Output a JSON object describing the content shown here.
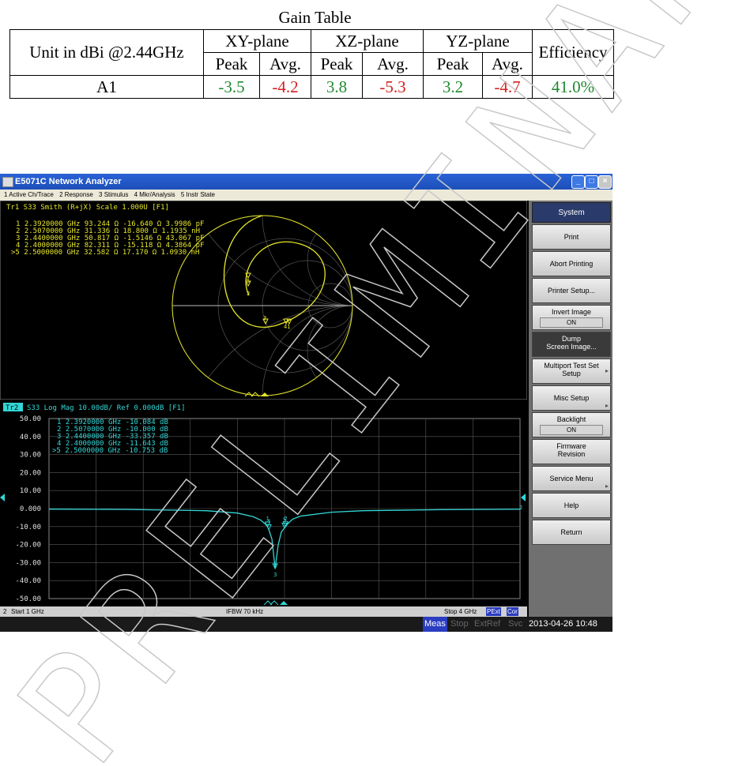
{
  "gain_table": {
    "title": "Gain Table",
    "unit_header": "Unit in dBi @2.44GHz",
    "planes": [
      "XY-plane",
      "XZ-plane",
      "YZ-plane"
    ],
    "efficiency_header": "Efficiency",
    "peak_label": "Peak",
    "avg_label": "Avg.",
    "row": {
      "name": "A1",
      "xy_peak": "-3.5",
      "xy_avg": "-4.2",
      "xz_peak": "3.8",
      "xz_avg": "-5.3",
      "yz_peak": "3.2",
      "yz_avg": "-4.7",
      "efficiency": "41.0%"
    }
  },
  "window": {
    "title": "E5071C Network Analyzer",
    "menu": [
      "1 Active Ch/Trace",
      "2 Response",
      "3 Stimulus",
      "4 Mkr/Analysis",
      "5 Instr State"
    ]
  },
  "smith": {
    "header": "Tr1  S33  Smith (R+jX)  Scale 1.000U  [F1]",
    "markers": [
      "1   2.3920000 GHz   93.244 Ω  -16.640 Ω   3.9986 pF",
      "2   2.5070000 GHz   31.336 Ω   18.800 Ω   1.1935 nH",
      "3   2.4400000 GHz   50.817 Ω  -1.5146 Ω  43.067 pF",
      "4   2.4000000 GHz   82.311 Ω  -15.118 Ω   4.3864 pF",
      ">5   2.5000000 GHz   32.582 Ω   17.170 Ω   1.0930 nH"
    ],
    "marker_tags": [
      "1",
      "2",
      "3",
      "4",
      "5",
      "41"
    ]
  },
  "logmag": {
    "trace_tag": "Tr2",
    "header": "S33  Log Mag  10.00dB/  Ref 0.000dB  [F1]",
    "markers": [
      "1   2.3920000 GHz  -10.084 dB",
      "2   2.5070000 GHz  -10.000 dB",
      "3   2.4400000 GHz  -33.357 dB",
      "4   2.4000000 GHz  -11.643 dB",
      ">5   2.5000000 GHz  -10.753 dB"
    ],
    "y_ticks": [
      "50.00",
      "40.00",
      "30.00",
      "20.00",
      "10.00",
      "0.000",
      "-10.00",
      "-20.00",
      "-30.00",
      "-40.00",
      "-50.00"
    ],
    "marker_tags": [
      "1",
      "2",
      "3",
      "4",
      "5"
    ],
    "ref_tag": "2"
  },
  "chart_data": {
    "type": "line",
    "xlabel": "",
    "ylabel": "",
    "xlim": [
      1,
      4
    ],
    "ylim": [
      -50,
      50
    ],
    "x": [
      1.0,
      1.5,
      2.0,
      2.2,
      2.3,
      2.35,
      2.38,
      2.392,
      2.4,
      2.42,
      2.44,
      2.46,
      2.48,
      2.5,
      2.507,
      2.52,
      2.55,
      2.6,
      2.8,
      3.0,
      3.5,
      4.0
    ],
    "series": [
      {
        "values": [
          -0.3,
          -0.5,
          -1.2,
          -2.5,
          -4.5,
          -6.5,
          -8.8,
          -10.084,
          -11.643,
          -17.0,
          -33.357,
          -20.0,
          -13.0,
          -10.753,
          -10.0,
          -8.5,
          -6.0,
          -4.2,
          -2.0,
          -1.2,
          -0.6,
          -0.4
        ]
      }
    ]
  },
  "status": {
    "channel": "2",
    "start": "Start 1 GHz",
    "ifbw": "IFBW 70 kHz",
    "stop": "Stop 4 GHz",
    "badges": [
      "PExt",
      "Cor"
    ]
  },
  "bottom": {
    "items": [
      "Meas",
      "Stop",
      "ExtRef",
      "Svc"
    ],
    "timestamp": "2013-04-26 10:48"
  },
  "softkeys": {
    "header": "System",
    "print": "Print",
    "abort": "Abort Printing",
    "printer_setup": "Printer Setup...",
    "invert_image": "Invert Image",
    "invert_value": "ON",
    "dump_1": "Dump",
    "dump_2": "Screen Image...",
    "multiport_1": "Multiport Test Set",
    "multiport_2": "Setup",
    "misc": "Misc Setup",
    "backlight": "Backlight",
    "backlight_value": "ON",
    "firmware_1": "Firmware",
    "firmware_2": "Revision",
    "service": "Service Menu",
    "help": "Help",
    "return": "Return"
  },
  "colors": {
    "trace1": "#e6e62a",
    "trace2": "#33d6d6",
    "grid": "#5a5a5a",
    "green": "#1e8a2e",
    "red": "#d42020"
  },
  "watermark": "PRELIMINARY"
}
